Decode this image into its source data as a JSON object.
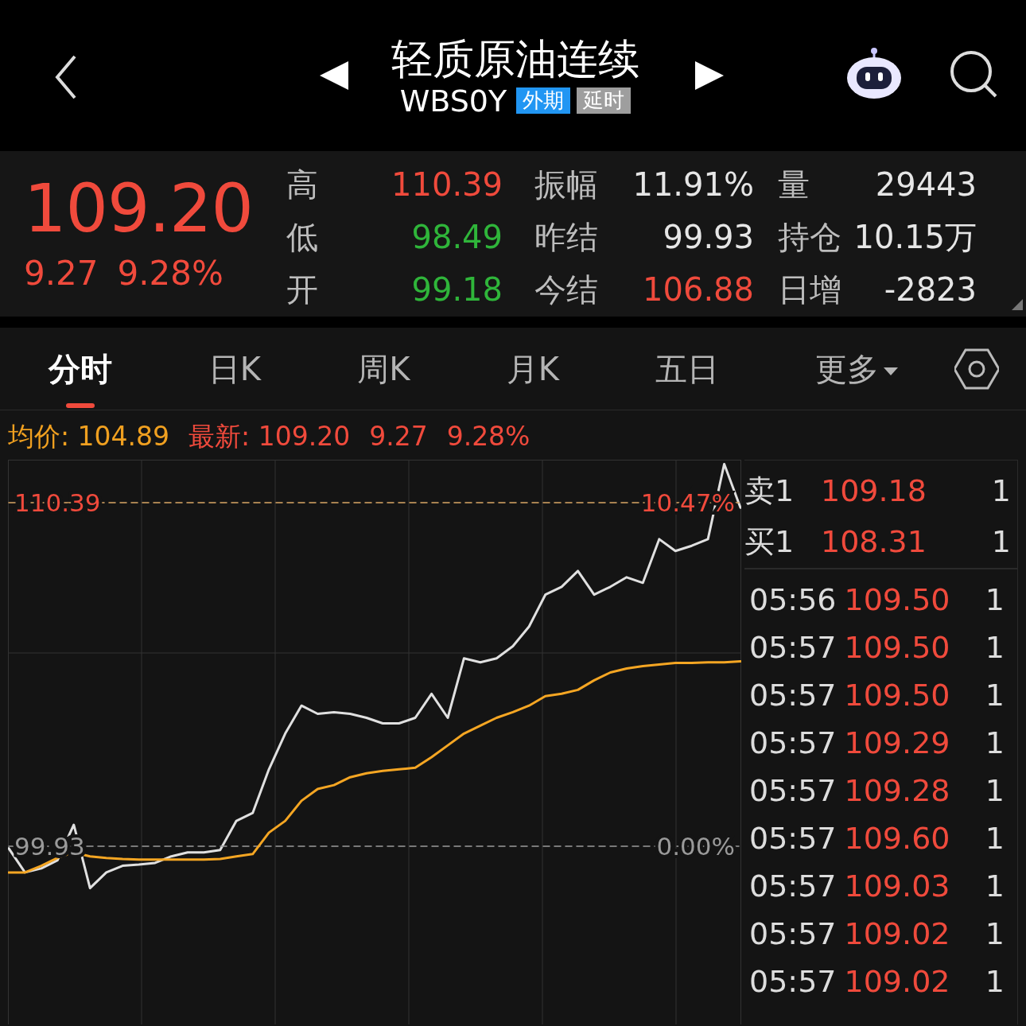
{
  "header": {
    "title": "轻质原油连续",
    "code": "WBS0Y",
    "badges": [
      {
        "label": "外期",
        "color": "#2196f3"
      },
      {
        "label": "延时",
        "color": "#9e9e9e"
      }
    ]
  },
  "quote": {
    "price": "109.20",
    "change": "9.27",
    "change_pct": "9.28%",
    "stats": [
      {
        "label": "高",
        "value": "110.39",
        "color": "#f04a3c"
      },
      {
        "label": "振幅",
        "value": "11.91%",
        "color": "#e6e6e6"
      },
      {
        "label": "量",
        "value": "29443",
        "color": "#e6e6e6"
      },
      {
        "label": "低",
        "value": "98.49",
        "color": "#2fb53a"
      },
      {
        "label": "昨结",
        "value": "99.93",
        "color": "#e6e6e6"
      },
      {
        "label": "持仓",
        "value": "10.15万",
        "color": "#e6e6e6"
      },
      {
        "label": "开",
        "value": "99.18",
        "color": "#2fb53a"
      },
      {
        "label": "今结",
        "value": "106.88",
        "color": "#f04a3c"
      },
      {
        "label": "日增",
        "value": "-2823",
        "color": "#e6e6e6"
      }
    ]
  },
  "tabs": [
    {
      "label": "分时",
      "selected": true,
      "kind": "plain"
    },
    {
      "label": "日K",
      "selected": false,
      "kind": "plain"
    },
    {
      "label": "周K",
      "selected": false,
      "kind": "plain"
    },
    {
      "label": "月K",
      "selected": false,
      "kind": "plain"
    },
    {
      "label": "五日",
      "selected": false,
      "kind": "plain"
    },
    {
      "label": "更多",
      "selected": false,
      "kind": "dropdown"
    }
  ],
  "summary": {
    "avg_label": "均价:",
    "avg_value": "104.89",
    "latest_label": "最新:",
    "latest_value": "109.20",
    "latest_change": "9.27",
    "latest_pct": "9.28%"
  },
  "chart": {
    "right_labels": [
      "10.47%",
      "0.00%"
    ],
    "chart_data": {
      "type": "line",
      "ylim": [
        94.5,
        111.7
      ],
      "grid": true,
      "yticks": [
        {
          "value": 110.39,
          "label": "110.39"
        },
        {
          "value": 99.93,
          "label": "99.93"
        }
      ],
      "series": [
        {
          "color": "#e0e0e0",
          "values": [
            99.86,
            99.13,
            99.25,
            99.5,
            100.58,
            98.65,
            99.13,
            99.33,
            99.37,
            99.42,
            99.62,
            99.74,
            99.74,
            99.81,
            100.7,
            100.94,
            102.27,
            103.36,
            104.21,
            103.96,
            104.01,
            103.96,
            103.84,
            103.67,
            103.67,
            103.84,
            104.57,
            103.84,
            105.65,
            105.53,
            105.65,
            106.02,
            106.62,
            107.59,
            107.83,
            108.31,
            107.59,
            107.83,
            108.12,
            107.95,
            109.28,
            108.92,
            109.08,
            109.28,
            111.57,
            110.24
          ]
        },
        {
          "color": "#d9a766",
          "line_style": "dashed",
          "values": [
            110.39,
            110.39,
            110.39,
            110.39,
            110.39,
            110.39,
            110.39,
            110.39,
            110.39,
            110.39,
            110.39,
            110.39,
            110.39,
            110.39,
            110.39,
            110.39,
            110.39,
            110.39,
            110.39,
            110.39,
            110.39,
            110.39,
            110.39,
            110.39,
            110.39,
            110.39,
            110.39,
            110.39,
            110.39,
            110.39,
            110.39,
            110.39,
            110.39,
            110.39,
            110.39,
            110.39,
            110.39,
            110.39,
            110.39,
            110.39,
            110.39,
            110.39,
            110.39,
            110.39,
            110.39,
            110.39
          ]
        },
        {
          "color": "#9a9a9a",
          "line_style": "dashed",
          "values": [
            99.93,
            99.93,
            99.93,
            99.93,
            99.93,
            99.93,
            99.93,
            99.93,
            99.93,
            99.93,
            99.93,
            99.93,
            99.93,
            99.93,
            99.93,
            99.93,
            99.93,
            99.93,
            99.93,
            99.93,
            99.93,
            99.93,
            99.93,
            99.93,
            99.93,
            99.93,
            99.93,
            99.93,
            99.93,
            99.93,
            99.93,
            99.93,
            99.93,
            99.93,
            99.93,
            99.93,
            99.93,
            99.93,
            99.93,
            99.93,
            99.93,
            99.93,
            99.93,
            99.93,
            99.93,
            99.93
          ]
        },
        {
          "color": "#f5a623",
          "values": [
            99.13,
            99.13,
            99.33,
            99.57,
            99.74,
            99.62,
            99.57,
            99.54,
            99.52,
            99.52,
            99.52,
            99.52,
            99.52,
            99.54,
            99.62,
            99.69,
            100.34,
            100.7,
            101.31,
            101.67,
            101.79,
            102.03,
            102.15,
            102.22,
            102.27,
            102.32,
            102.64,
            103.0,
            103.36,
            103.6,
            103.84,
            104.01,
            104.21,
            104.5,
            104.57,
            104.69,
            104.98,
            105.22,
            105.34,
            105.41,
            105.46,
            105.51,
            105.51,
            105.53,
            105.53,
            105.56
          ]
        }
      ]
    }
  },
  "order_book": [
    {
      "label": "卖1",
      "price": "109.18",
      "volume": "1"
    },
    {
      "label": "买1",
      "price": "108.31",
      "volume": "1"
    }
  ],
  "ticks": [
    {
      "time": "05:56",
      "price": "109.50",
      "volume": "1"
    },
    {
      "time": "05:57",
      "price": "109.50",
      "volume": "1"
    },
    {
      "time": "05:57",
      "price": "109.50",
      "volume": "1"
    },
    {
      "time": "05:57",
      "price": "109.29",
      "volume": "1"
    },
    {
      "time": "05:57",
      "price": "109.28",
      "volume": "1"
    },
    {
      "time": "05:57",
      "price": "109.60",
      "volume": "1"
    },
    {
      "time": "05:57",
      "price": "109.03",
      "volume": "1"
    },
    {
      "time": "05:57",
      "price": "109.02",
      "volume": "1"
    },
    {
      "time": "05:57",
      "price": "109.02",
      "volume": "1"
    }
  ]
}
